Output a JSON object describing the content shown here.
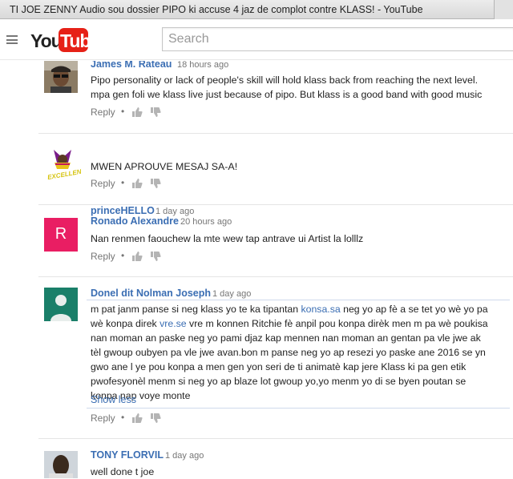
{
  "window": {
    "title": "TI JOE ZENNY Audio sou dossier PIPO ki accuse 4 jaz de complot contre KLASS! - YouTube"
  },
  "header": {
    "logo_you": "You",
    "logo_tube": "Tube",
    "search_placeholder": "Search"
  },
  "comments": [
    {
      "author": "James M. Rateau",
      "time": "18 hours ago",
      "lines": [
        "Pipo personality or lack of people's skill will hold klass back from reaching the next level.",
        "mpa gen foli we klass live just because of pipo. But klass is a good band with good music"
      ],
      "reply_label": "Reply"
    },
    {
      "author": "princeHELLO",
      "time": "1 day ago",
      "lines": [
        "MWEN APROUVE MESAJ SA-A!"
      ],
      "avatar_text": "EXCELLENT",
      "reply_label": "Reply"
    },
    {
      "author": "Ronado Alexandre",
      "time": "20 hours ago",
      "lines": [
        "Nan renmen faouchew la mte wew tap antrave ui  Artist la lolllz"
      ],
      "avatar_letter": "R",
      "avatar_color": "#e91e63",
      "reply_label": "Reply"
    },
    {
      "author": "Donel dit Nolman Joseph",
      "time": "1 day ago",
      "line1_a": "m pat janm panse si neg klass yo te ka tipantan ",
      "line1_link": "konsa.sa",
      "line1_b": " neg yo ap fè a se tet yo wè yo pa",
      "line2_a": "wè konpa direk ",
      "line2_link": "vre.se",
      "line2_b": " vre m konnen Ritchie fè anpil pou konpa dirèk men m pa wè poukisa",
      "lines_rest": [
        "nan moman an paske neg yo pami djaz kap mennen nan moman an gentan pa vle jwe ak",
        "tèl gwoup oubyen pa vle jwe avan.bon m panse neg yo ap resezi yo paske ane 2016 se yn",
        "gwo ane l ye pou konpa a men gen yon seri de ti animatè kap jere Klass ki pa gen etik",
        "pwofesyonèl menm si neg yo ap blaze lot gwoup yo,yo menm yo di se byen poutan se",
        "konpa nap voye monte"
      ],
      "show_less": "Show less",
      "reply_label": "Reply"
    },
    {
      "author": "TONY FLORVIL",
      "time": "1 day ago",
      "lines": [
        "well done t joe"
      ]
    }
  ],
  "colors": {
    "link_blue": "#3b6eb3",
    "youtube_red": "#e62117",
    "meta_gray": "#767676"
  }
}
